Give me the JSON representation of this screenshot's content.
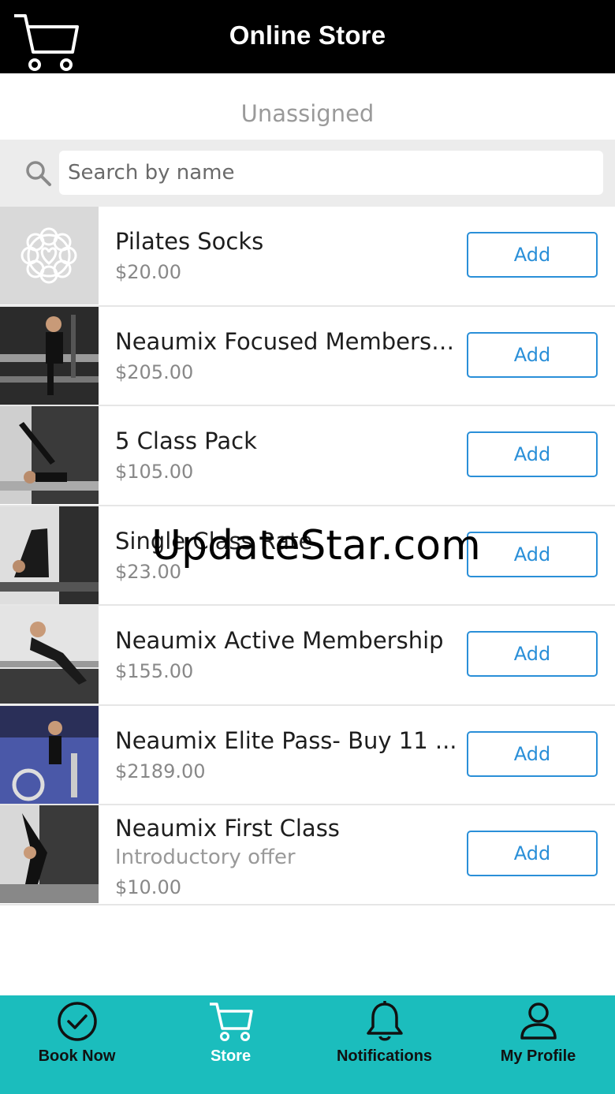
{
  "header": {
    "title": "Online Store",
    "cart_icon": "cart-icon"
  },
  "assignment": {
    "label": "Unassigned"
  },
  "search": {
    "placeholder": "Search by name",
    "icon": "search-icon"
  },
  "products": [
    {
      "name": "Pilates Socks",
      "subtitle": "",
      "price": "$20.00",
      "add_label": "Add",
      "thumb": "logo-placeholder"
    },
    {
      "name": "Neaumix Focused Membersh...",
      "subtitle": "",
      "price": "$205.00",
      "add_label": "Add",
      "thumb": "photo"
    },
    {
      "name": "5 Class Pack",
      "subtitle": "",
      "price": "$105.00",
      "add_label": "Add",
      "thumb": "photo"
    },
    {
      "name": "Single Class Rate",
      "subtitle": "",
      "price": "$23.00",
      "add_label": "Add",
      "thumb": "photo"
    },
    {
      "name": "Neaumix Active Membership",
      "subtitle": "",
      "price": "$155.00",
      "add_label": "Add",
      "thumb": "photo"
    },
    {
      "name": "Neaumix Elite Pass- Buy 11 ...",
      "subtitle": "",
      "price": "$2189.00",
      "add_label": "Add",
      "thumb": "photo"
    },
    {
      "name": "Neaumix First Class",
      "subtitle": "Introductory offer",
      "price": "$10.00",
      "add_label": "Add",
      "thumb": "photo"
    }
  ],
  "watermark": "UpdateStar.com",
  "bottom_nav": [
    {
      "label": "Book Now",
      "icon": "check-circle-icon",
      "active": false
    },
    {
      "label": "Store",
      "icon": "cart-icon",
      "active": true
    },
    {
      "label": "Notifications",
      "icon": "bell-icon",
      "active": false
    },
    {
      "label": "My Profile",
      "icon": "user-icon",
      "active": false
    }
  ],
  "colors": {
    "accent": "#2a8fd8",
    "nav_bg": "#1bbdbd",
    "header_bg": "#000000"
  }
}
